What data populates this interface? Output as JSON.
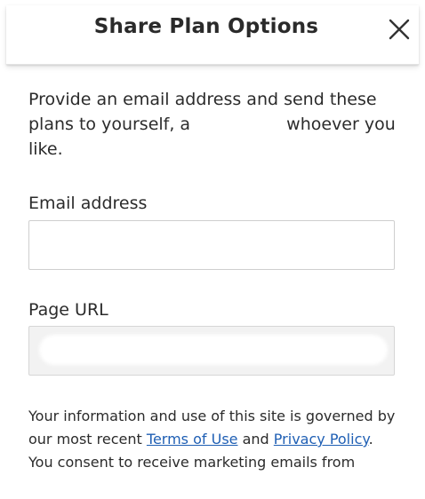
{
  "dialog": {
    "title": "Share Plan Options",
    "close_icon": "close-icon"
  },
  "intro": {
    "part1": "Provide an email address and send these plans to yourself, a",
    "part2": "whoever you like."
  },
  "email_field": {
    "label": "Email address",
    "value": "",
    "placeholder": ""
  },
  "url_field": {
    "label": "Page URL",
    "value": ""
  },
  "legal": {
    "prefix": "Your information and use of this site is governed by our most recent",
    "terms_link": "Terms of Use",
    "and": "and",
    "privacy_link": "Privacy Policy",
    "suffix": ". You consent to receive marketing emails from"
  },
  "colors": {
    "link": "#1f5fb4",
    "text": "#2b2b2b",
    "readonly_field_bg": "#f2f2f2"
  }
}
